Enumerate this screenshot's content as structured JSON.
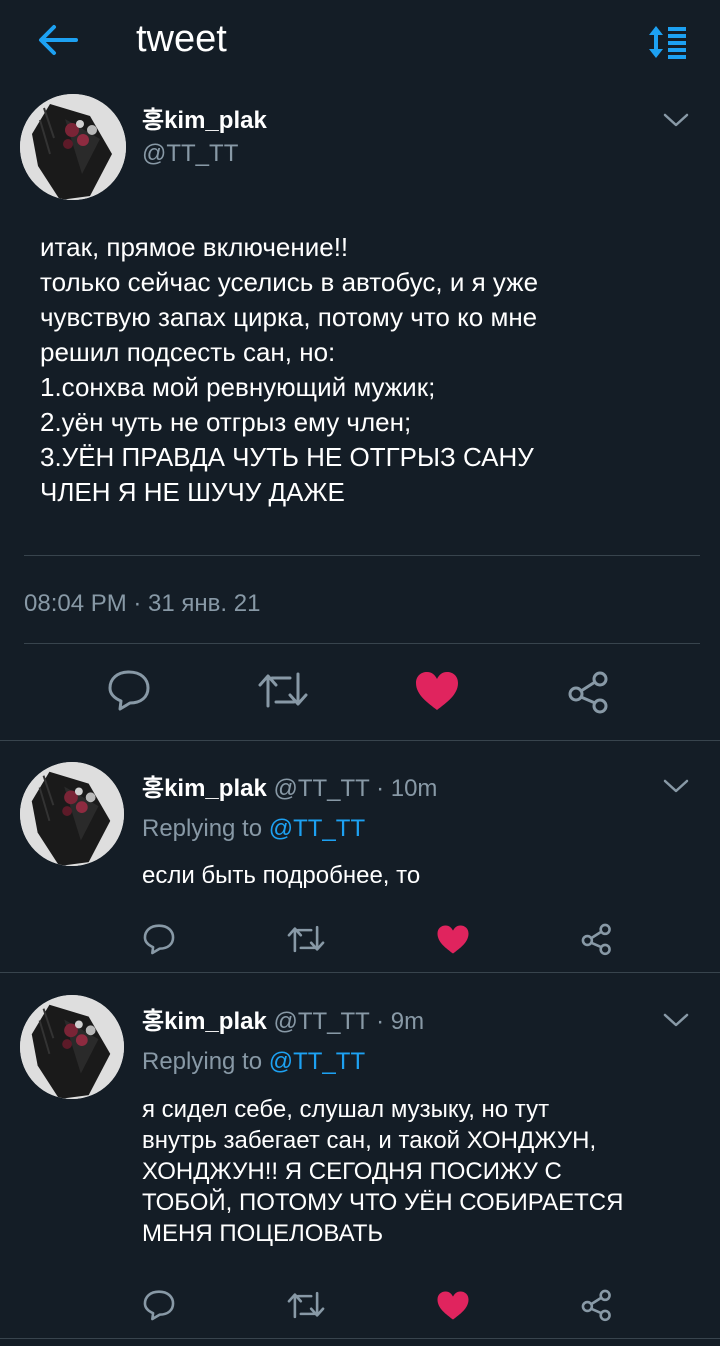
{
  "header": {
    "title": "tweet"
  },
  "main_tweet": {
    "name": "홍kim_plak",
    "handle": "@TT_TT",
    "lines": [
      "итак, прямое включение!!",
      "только сейчас уселись в автобус, и я уже",
      "чувствую запах цирка, потому что ко мне",
      "решил подсесть сан, но:",
      "1.сонхва мой ревнующий мужик;",
      "2.уён чуть не отгрыз ему член;",
      "3.УЁН ПРАВДА ЧУТЬ НЕ ОТГРЫЗ САНУ",
      "ЧЛЕН Я НЕ ШУЧУ ДАЖЕ"
    ],
    "timestamp": "08:04 PM · 31 янв. 21"
  },
  "replies": [
    {
      "name": "홍kim_plak",
      "meta": " @TT_TT · 10m",
      "replying_label": "Replying to ",
      "replying_to": "@TT_TT",
      "lines": [
        "если быть подробнее, то"
      ]
    },
    {
      "name": "홍kim_plak",
      "meta": " @TT_TT · 9m",
      "replying_label": "Replying to ",
      "replying_to": "@TT_TT",
      "lines": [
        "я сидел себе, слушал музыку, но тут",
        "внутрь забегает сан, и такой ХОНДЖУН,",
        "ХОНДЖУН!! Я СЕГОДНЯ ПОСИЖУ С",
        "ТОБОЙ, ПОТОМУ ЧТО УЁН СОБИРАЕТСЯ",
        "МЕНЯ ПОЦЕЛОВАТЬ"
      ]
    }
  ],
  "icons": {
    "back": "arrow-left-icon",
    "sort": "sort-icon",
    "chevron": "chevron-down-icon",
    "reply": "reply-icon",
    "retweet": "retweet-icon",
    "like": "heart-icon",
    "share": "share-icon"
  },
  "colors": {
    "background": "#141d26",
    "accent": "#1da1f2",
    "muted": "#8899a6",
    "like": "#e0245e",
    "divider": "#38444d"
  }
}
